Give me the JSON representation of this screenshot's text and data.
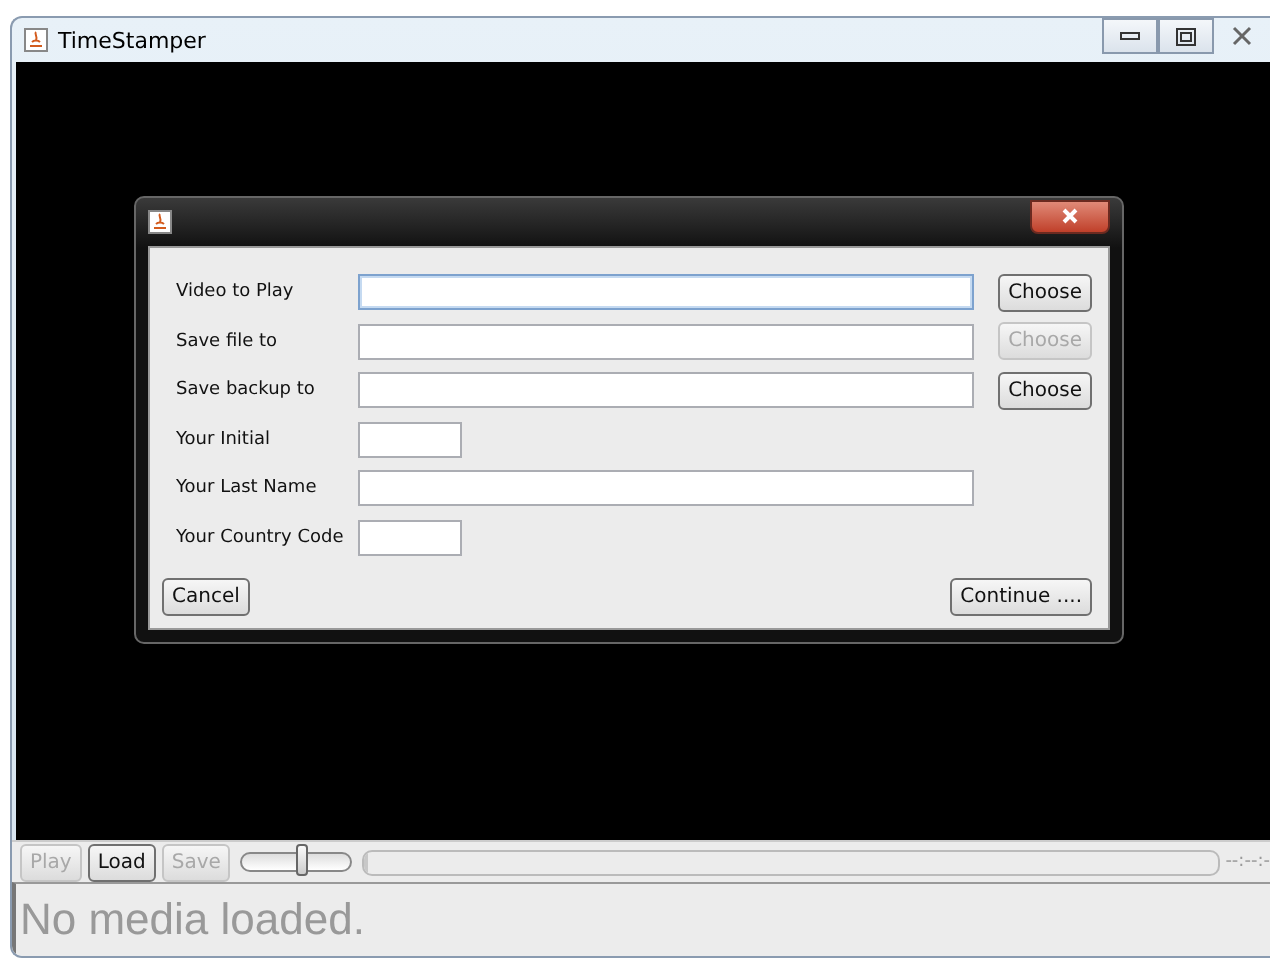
{
  "window": {
    "title": "TimeStamper"
  },
  "dialog": {
    "rows": [
      {
        "label": "Video to Play",
        "kind": "wide",
        "focused": true,
        "button": {
          "label": "Choose",
          "disabled": false
        }
      },
      {
        "label": "Save file to",
        "kind": "wide",
        "focused": false,
        "button": {
          "label": "Choose",
          "disabled": true
        }
      },
      {
        "label": "Save backup to",
        "kind": "wide",
        "focused": false,
        "button": {
          "label": "Choose",
          "disabled": false
        }
      },
      {
        "label": "Your Initial",
        "kind": "short",
        "focused": false
      },
      {
        "label": "Your Last Name",
        "kind": "wide",
        "focused": false
      },
      {
        "label": "Your Country Code",
        "kind": "short",
        "focused": false
      }
    ],
    "cancel": "Cancel",
    "continue": "Continue ...."
  },
  "toolbar": {
    "buttons": [
      {
        "label": "Play",
        "disabled": true
      },
      {
        "label": "Load",
        "disabled": false
      },
      {
        "label": "Save",
        "disabled": true
      }
    ],
    "volume": {
      "level": 0.55
    },
    "progress": {
      "level": 0
    },
    "time": "--:--:-"
  },
  "status": "No media loaded."
}
